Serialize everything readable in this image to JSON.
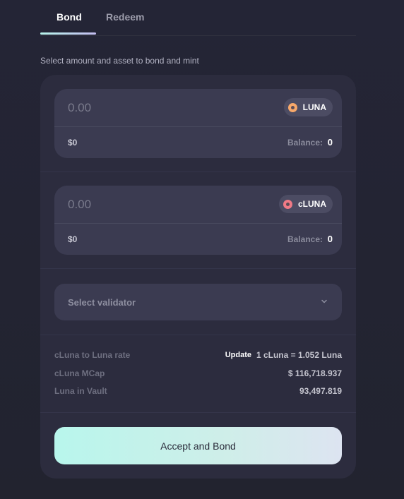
{
  "tabs": {
    "bond": "Bond",
    "redeem": "Redeem",
    "active": "Bond"
  },
  "subtitle": "Select amount and asset to bond and mint",
  "input_asset": {
    "amount_placeholder": "0.00",
    "token": "LUNA",
    "usd_value": "$0",
    "balance_label": "Balance:",
    "balance_value": "0"
  },
  "output_asset": {
    "amount_placeholder": "0.00",
    "token": "cLUNA",
    "usd_value": "$0",
    "balance_label": "Balance:",
    "balance_value": "0"
  },
  "validator": {
    "placeholder": "Select validator",
    "icon": "chevron-down-icon"
  },
  "stats": {
    "rate_label": "cLuna to Luna rate",
    "update_label": "Update",
    "rate_value": "1 cLuna = 1.052 Luna",
    "mcap_label": "cLuna MCap",
    "mcap_value": "$ 116,718.937",
    "vault_label": "Luna in Vault",
    "vault_value": "93,497.819"
  },
  "cta_label": "Accept and Bond",
  "colors": {
    "background": "#242536",
    "card": "#2c2c3e",
    "field": "#3b3b51",
    "accent_gradient_start": "#b8f6ec",
    "accent_gradient_end": "#dde4f1",
    "luna_coin": "#f7a86a",
    "cluna_coin": "#f07a86"
  }
}
